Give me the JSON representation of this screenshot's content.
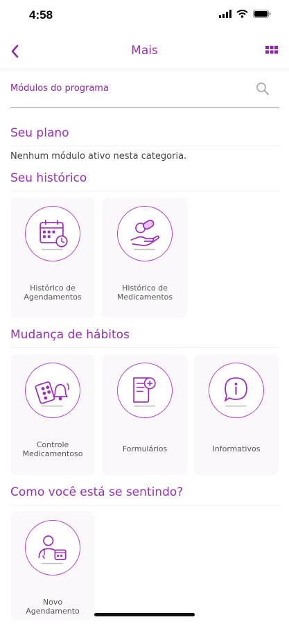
{
  "status": {
    "time": "4:58"
  },
  "nav": {
    "title": "Mais"
  },
  "search": {
    "placeholder": "Módulos do programa"
  },
  "sections": {
    "plan": {
      "title": "Seu plano",
      "empty": "Nenhum módulo ativo nesta categoria."
    },
    "history": {
      "title": "Seu histórico",
      "items": [
        {
          "line1": "Histórico de",
          "line2": "Agendamentos",
          "icon": "calendar-clock-icon"
        },
        {
          "line1": "Histórico de",
          "line2": "Medicamentos",
          "icon": "pill-hand-icon"
        }
      ]
    },
    "habits": {
      "title": "Mudança de hábitos",
      "items": [
        {
          "line1": "Controle",
          "line2": "Medicamentoso",
          "icon": "pills-bell-icon"
        },
        {
          "line1": "Formulários",
          "line2": "",
          "icon": "form-add-icon"
        },
        {
          "line1": "Informativos",
          "line2": "",
          "icon": "info-chat-icon"
        }
      ]
    },
    "feeling": {
      "title": "Como você está se sentindo?",
      "items": [
        {
          "line1": "Novo",
          "line2": "Agendamento",
          "icon": "doctor-calendar-icon"
        }
      ]
    }
  },
  "colors": {
    "accent": "#9b2fb5",
    "icon": "#b145c8",
    "card": "#faf8fa"
  }
}
